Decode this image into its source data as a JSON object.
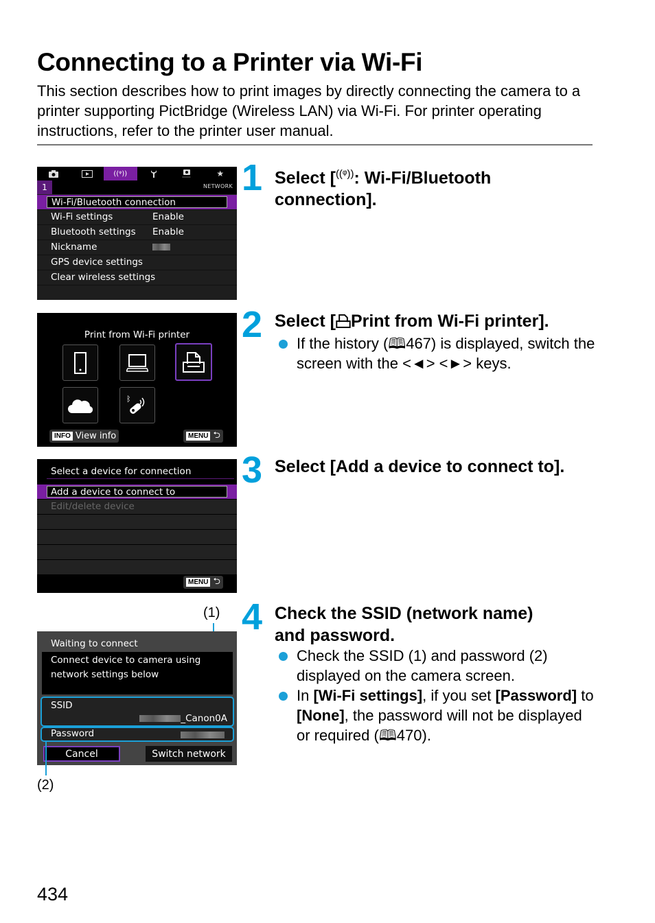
{
  "page": {
    "title": "Connecting to a Printer via Wi-Fi",
    "intro": "This section describes how to print images by directly connecting the camera to a printer supporting PictBridge (Wireless LAN) via Wi-Fi. For printer operating instructions, refer to the printer user manual.",
    "page_number": "434"
  },
  "screen1": {
    "tabs": [
      "camera-icon",
      "playback-icon",
      "wireless-icon",
      "wrench-icon",
      "custom-icon",
      "star-icon"
    ],
    "active_tab": "wireless-icon",
    "sub_number": "1",
    "sub_name": "NETWORK",
    "items": [
      {
        "label": "Wi-Fi/Bluetooth connection",
        "value": ""
      },
      {
        "label": "Wi-Fi settings",
        "value": "Enable"
      },
      {
        "label": "Bluetooth settings",
        "value": "Enable"
      },
      {
        "label": "Nickname",
        "value": ""
      },
      {
        "label": "GPS device settings",
        "value": ""
      },
      {
        "label": "Clear wireless settings",
        "value": ""
      }
    ]
  },
  "screen2": {
    "title": "Print from Wi-Fi printer",
    "tiles": [
      "smartphone-icon",
      "computer-icon",
      "printer-icon",
      "cloud-icon",
      "bluetooth-remote-icon"
    ],
    "selected_tile": "printer-icon",
    "info_key": "INFO",
    "info_label": "View info",
    "menu_key": "MENU",
    "back_glyph": "⮌"
  },
  "screen3": {
    "header": "Select a device for connection",
    "items": [
      {
        "label": "Add a device to connect to",
        "state": "selected"
      },
      {
        "label": "Edit/delete device",
        "state": "disabled"
      }
    ],
    "menu_key": "MENU",
    "back_glyph": "⮌"
  },
  "screen4": {
    "header": "Waiting to connect",
    "message_line1": "Connect device to camera using",
    "message_line2": "network settings below",
    "ssid_label": "SSID",
    "ssid_value": "_Canon0A",
    "password_label": "Password",
    "cancel_label": "Cancel",
    "switch_label": "Switch network",
    "callout1": "(1)",
    "callout2": "(2)"
  },
  "steps": [
    {
      "number": "1",
      "heading_prefix": "Select [",
      "heading_icon": "wireless-icon",
      "heading_suffix": ": Wi-Fi/Bluetooth connection]."
    },
    {
      "number": "2",
      "heading_prefix": "Select [",
      "heading_icon": "printer-icon",
      "heading_suffix": "Print from Wi-Fi printer].",
      "bullets": [
        "If the history (🕮467) is displayed, switch the screen with the <◄> <►> keys."
      ]
    },
    {
      "number": "3",
      "heading": "Select [Add a device to connect to]."
    },
    {
      "number": "4",
      "heading": "Check the SSID (network name) and password.",
      "bullets": [
        "Check the SSID (1) and password (2) displayed on the camera screen."
      ],
      "bullet2": {
        "pre": "In ",
        "b1": "[Wi-Fi settings]",
        "mid1": ", if you set ",
        "b2": "[Password]",
        "mid2": " to ",
        "b3": "[None]",
        "post": ", the password will not be displayed or required (",
        "ref": "470",
        "end": ")."
      }
    }
  ]
}
